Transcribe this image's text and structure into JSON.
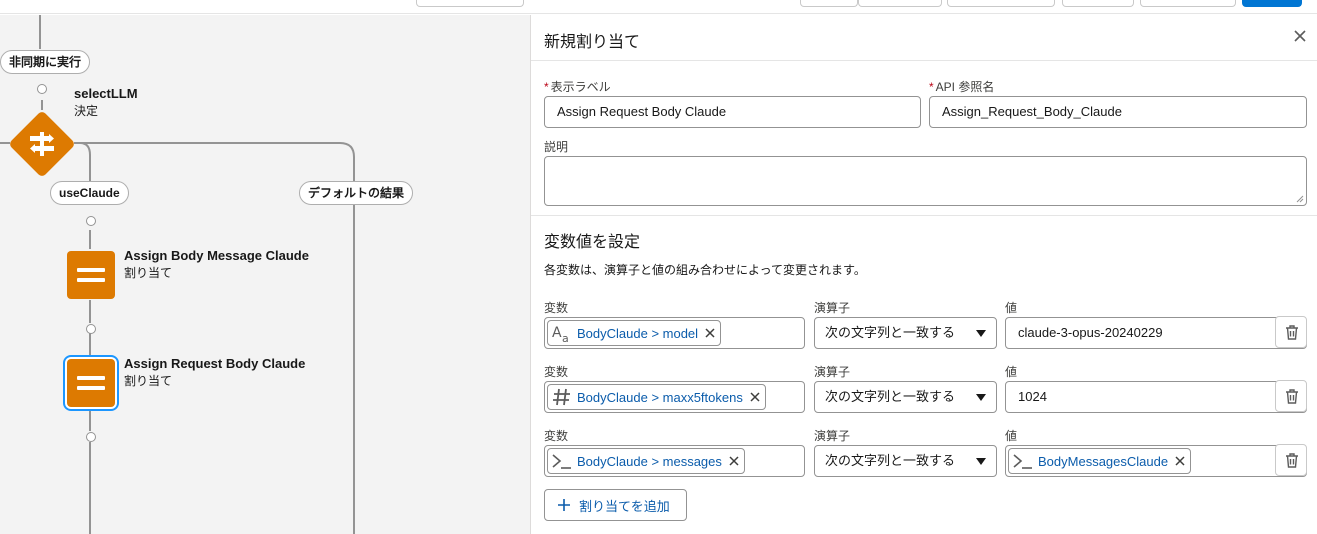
{
  "flow": {
    "async_path_label": "非同期に実行",
    "decision": {
      "title": "selectLLM",
      "type": "決定"
    },
    "outcomes": [
      "useClaude",
      "デフォルトの結果"
    ],
    "nodes": [
      {
        "title": "Assign Body Message Claude",
        "type": "割り当て",
        "selected": false
      },
      {
        "title": "Assign Request Body Claude",
        "type": "割り当て",
        "selected": true
      }
    ]
  },
  "panel": {
    "title": "新規割り当て",
    "label_field": {
      "label": "表示ラベル",
      "value": "Assign Request Body Claude"
    },
    "api_field": {
      "label": "API 参照名",
      "value": "Assign_Request_Body_Claude"
    },
    "description": {
      "label": "説明",
      "value": ""
    },
    "section_title": "変数値を設定",
    "section_desc": "各変数は、演算子と値の組み合わせによって変更されます。",
    "col_variable": "変数",
    "col_operator": "演算子",
    "col_value": "値",
    "rows": [
      {
        "variable": "BodyClaude > model",
        "var_icon": "text-variable-icon",
        "operator": "次の文字列と一致する",
        "value": "claude-3-opus-20240229",
        "value_is_chip": false
      },
      {
        "variable": "BodyClaude > maxx5ftokens",
        "var_icon": "number-variable-icon",
        "operator": "次の文字列と一致する",
        "value": "1024",
        "value_is_chip": false
      },
      {
        "variable": "BodyClaude > messages",
        "var_icon": "apex-variable-icon",
        "operator": "次の文字列と一致する",
        "value": "BodyMessagesClaude",
        "value_is_chip": true
      }
    ],
    "add_button": "割り当てを追加"
  },
  "colors": {
    "node_orange": "#dd7a01",
    "brand_blue": "#0176d3",
    "link_blue": "#0b5cab",
    "required_red": "#ba0517",
    "selection_blue": "#1b96ff"
  }
}
